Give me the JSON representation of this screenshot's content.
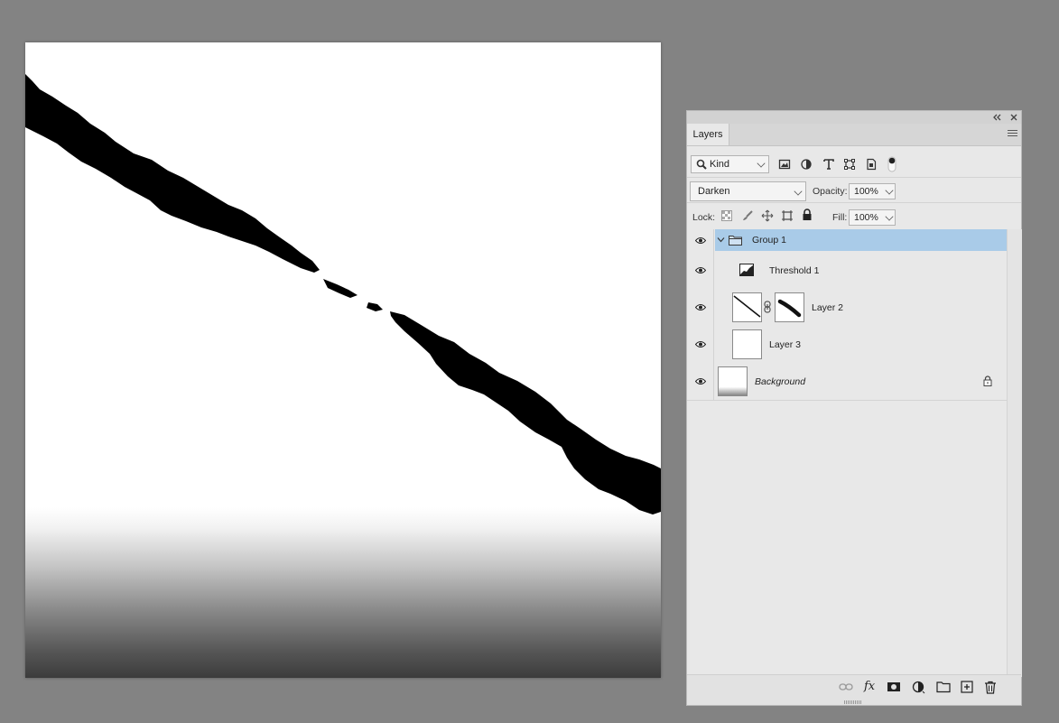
{
  "panel": {
    "collapse_icon": "double-left-chevron",
    "close_icon": "close-x",
    "tab_label": "Layers",
    "menu_icon": "hamburger-menu",
    "filter": {
      "kind_label": "Kind",
      "icons": [
        "pixel-filter-icon",
        "adjustment-filter-icon",
        "type-filter-icon",
        "shape-filter-icon",
        "smart-object-filter-icon",
        "filter-toggle-icon"
      ]
    },
    "blend_mode": "Darken",
    "opacity_label": "Opacity:",
    "opacity_value": "100%",
    "lock_label": "Lock:",
    "lock_icons": [
      "lock-transparent-icon",
      "lock-image-icon",
      "lock-position-icon",
      "lock-artboard-icon",
      "lock-all-icon"
    ],
    "fill_label": "Fill:",
    "fill_value": "100%",
    "selected_color": "#a9cbe8",
    "layers": [
      {
        "name": "Group 1",
        "type": "group",
        "expanded": true,
        "selected": true
      },
      {
        "name": "Threshold 1",
        "type": "adjustment",
        "adjustment_icon": "threshold-icon"
      },
      {
        "name": "Layer 2",
        "type": "pixel",
        "has_mask": true,
        "linked": true
      },
      {
        "name": "Layer 3",
        "type": "pixel"
      },
      {
        "name": "Background",
        "type": "background",
        "italic": true,
        "locked": true
      }
    ],
    "bottom_icons": [
      "link-layers-icon",
      "fx-icon",
      "add-mask-icon",
      "new-fill-adjustment-icon",
      "new-group-icon",
      "new-layer-icon",
      "delete-layer-icon"
    ],
    "fx_label": "fx"
  },
  "canvas": {
    "background": "#ffffff",
    "stroke_color": "#000000",
    "gradient_bottom_color": "#3a3a3a"
  }
}
